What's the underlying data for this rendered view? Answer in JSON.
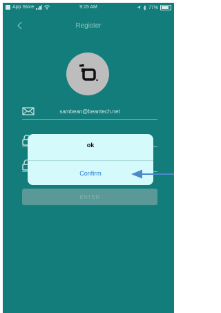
{
  "status_bar": {
    "carrier": "App Store",
    "time": "9:15 AM",
    "battery": "77%"
  },
  "nav": {
    "title": "Register"
  },
  "form": {
    "email_value": "sambean@beantech.net",
    "enter_label": "ENTER"
  },
  "dialog": {
    "message": "ok",
    "confirm_label": "Confirm"
  },
  "colors": {
    "background": "#137d7b",
    "dialog_bg": "#d4fafc",
    "link_blue": "#1f7bd4",
    "arrow_blue": "#4a8ac8"
  }
}
